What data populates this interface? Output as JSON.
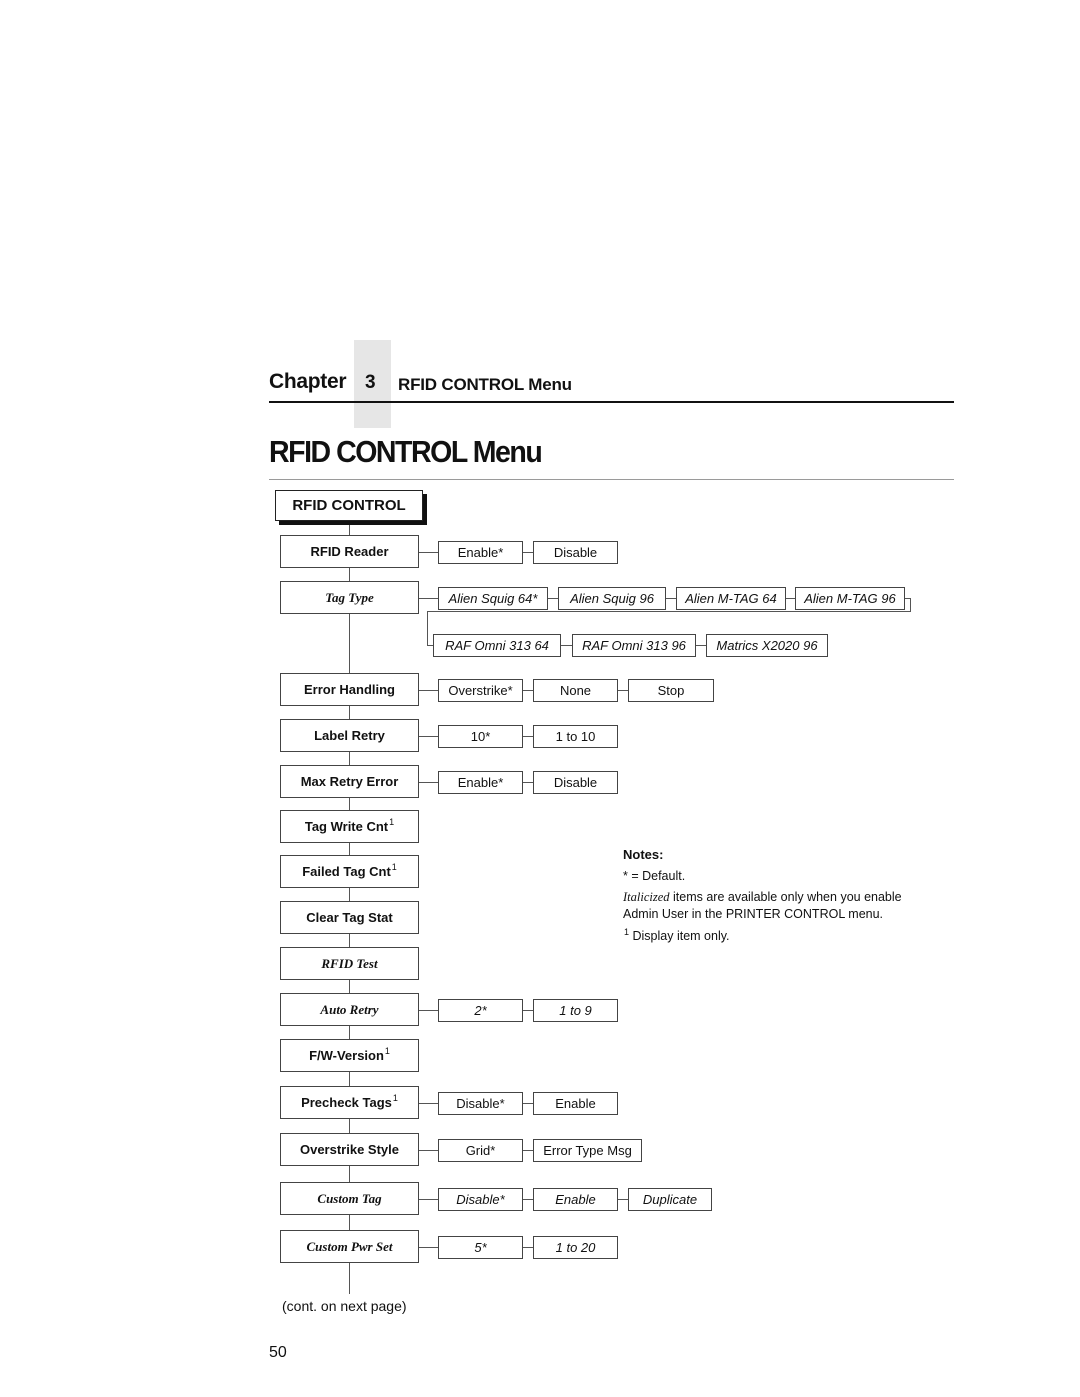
{
  "header": {
    "chapter_word": "Chapter",
    "chapter_number": "3",
    "chapter_title": "RFID CONTROL Menu"
  },
  "page_title": "RFID CONTROL Menu",
  "menu": {
    "root": "RFID CONTROL",
    "items": [
      {
        "label": "RFID Reader",
        "italic": false,
        "superscript": "",
        "options": [
          "Enable*",
          "Disable"
        ]
      },
      {
        "label": "Tag Type",
        "italic": true,
        "superscript": "",
        "options": [
          "Alien Squig 64*",
          "Alien Squig 96",
          "Alien M-TAG 64",
          "Alien M-TAG 96",
          "RAF Omni 313 64",
          "RAF Omni 313 96",
          "Matrics X2020 96"
        ]
      },
      {
        "label": "Error Handling",
        "italic": false,
        "superscript": "",
        "options": [
          "Overstrike*",
          "None",
          "Stop"
        ]
      },
      {
        "label": "Label Retry",
        "italic": false,
        "superscript": "",
        "options": [
          "10*",
          "1 to 10"
        ]
      },
      {
        "label": "Max Retry Error",
        "italic": false,
        "superscript": "",
        "options": [
          "Enable*",
          "Disable"
        ]
      },
      {
        "label": "Tag Write Cnt",
        "italic": false,
        "superscript": "1",
        "options": []
      },
      {
        "label": "Failed Tag Cnt",
        "italic": false,
        "superscript": "1",
        "options": []
      },
      {
        "label": "Clear Tag Stat",
        "italic": false,
        "superscript": "",
        "options": []
      },
      {
        "label": "RFID Test",
        "italic": true,
        "superscript": "",
        "options": []
      },
      {
        "label": "Auto Retry",
        "italic": true,
        "superscript": "",
        "options": [
          "2*",
          "1 to 9"
        ]
      },
      {
        "label": "F/W-Version",
        "italic": false,
        "superscript": "1",
        "options": []
      },
      {
        "label": "Precheck Tags",
        "italic": false,
        "superscript": "1",
        "options": [
          "Disable*",
          "Enable"
        ]
      },
      {
        "label": "Overstrike Style",
        "italic": false,
        "superscript": "",
        "options": [
          "Grid*",
          "Error Type Msg"
        ]
      },
      {
        "label": "Custom Tag",
        "italic": true,
        "superscript": "",
        "options": [
          "Disable*",
          "Enable",
          "Duplicate"
        ]
      },
      {
        "label": "Custom Pwr Set",
        "italic": true,
        "superscript": "",
        "options": [
          "5*",
          "1 to 20"
        ]
      }
    ]
  },
  "notes": {
    "heading": "Notes:",
    "default_note": "* = Default.",
    "italic_word": "Italicized",
    "italic_note_rest": " items are available only when you enable",
    "italic_note_line2": "Admin User in the PRINTER CONTROL menu.",
    "footnote_mark": "1",
    "footnote_text": " Display item only."
  },
  "continuation": "(cont. on next page)",
  "page_number": "50"
}
